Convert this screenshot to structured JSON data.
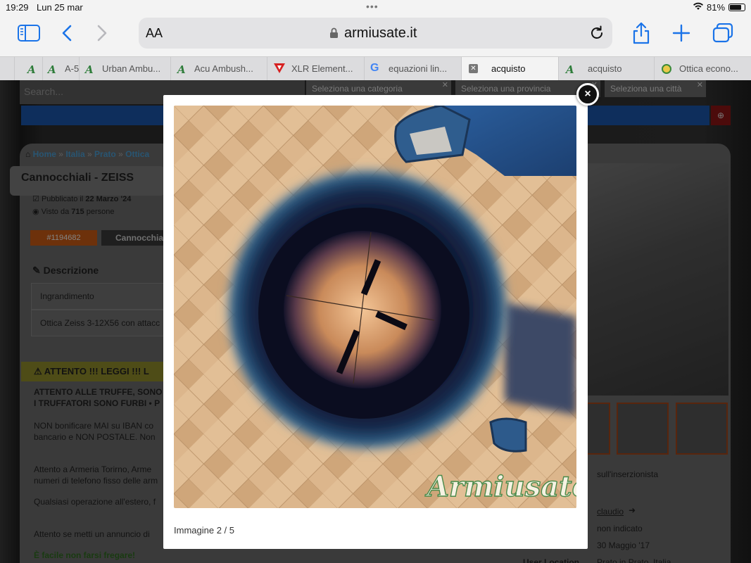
{
  "status": {
    "time": "19:29",
    "date": "Lun 25 mar",
    "battery": "81%",
    "battery_level": 0.81
  },
  "toolbar": {
    "aa_label": "AA",
    "url": "armiusate.it"
  },
  "tabs": [
    {
      "label": "A-5"
    },
    {
      "label": "Urban Ambu..."
    },
    {
      "label": "Acu Ambush..."
    },
    {
      "label": "XLR Element..."
    },
    {
      "label": "equazioni lin..."
    },
    {
      "label": "acquisto"
    },
    {
      "label": "acquisto"
    },
    {
      "label": "Ottica econo..."
    }
  ],
  "page": {
    "search_placeholder": "Search...",
    "select_category": "Seleziona una categoria",
    "select_province": "Seleziona una provincia",
    "select_city": "Seleziona una città",
    "breadcrumb": [
      "Home",
      "Italia",
      "Prato",
      "Ottica"
    ],
    "title": "Cannocchiali - ZEISS",
    "published_label": "Pubblicato il",
    "published_date": "22 Marzo '24",
    "views_label": "Visto da",
    "views_count": "715",
    "views_suffix": "persone",
    "ad_id": "#1194682",
    "category": "Cannocchia",
    "description_heading": "Descrizione",
    "desc_row1": "Ingrandimento",
    "desc_row2": "Ottica Zeiss 3-12X56 con attacc",
    "warning_heading": "ATTENTO !!! LEGGI !!! L",
    "warn_lines": [
      "ATTENTO ALLE TRUFFE, SONO",
      "I TRUFFATORI SONO FURBI • P",
      "NON bonificare MAI su IBAN co",
      "bancario e NON POSTALE. Non",
      "Attento a Armeria Torirno, Arme",
      "numeri di telefono fisso delle arm",
      "Qualsiasi operazione all'estero, f",
      "Attento se metti un annuncio di",
      "È facile non farsi fregare!"
    ],
    "seller_info": "sull'inserzionista",
    "seller_name": "claudio",
    "seller_phone": "non indicato",
    "seller_since": "30 Maggio '17",
    "seller_location": "Prato in Prato, Italia",
    "seller_location_label": "User Location",
    "watermark": "Armiusate.it"
  },
  "lightbox": {
    "caption": "Immagine 2 / 5",
    "close_label": "×"
  }
}
